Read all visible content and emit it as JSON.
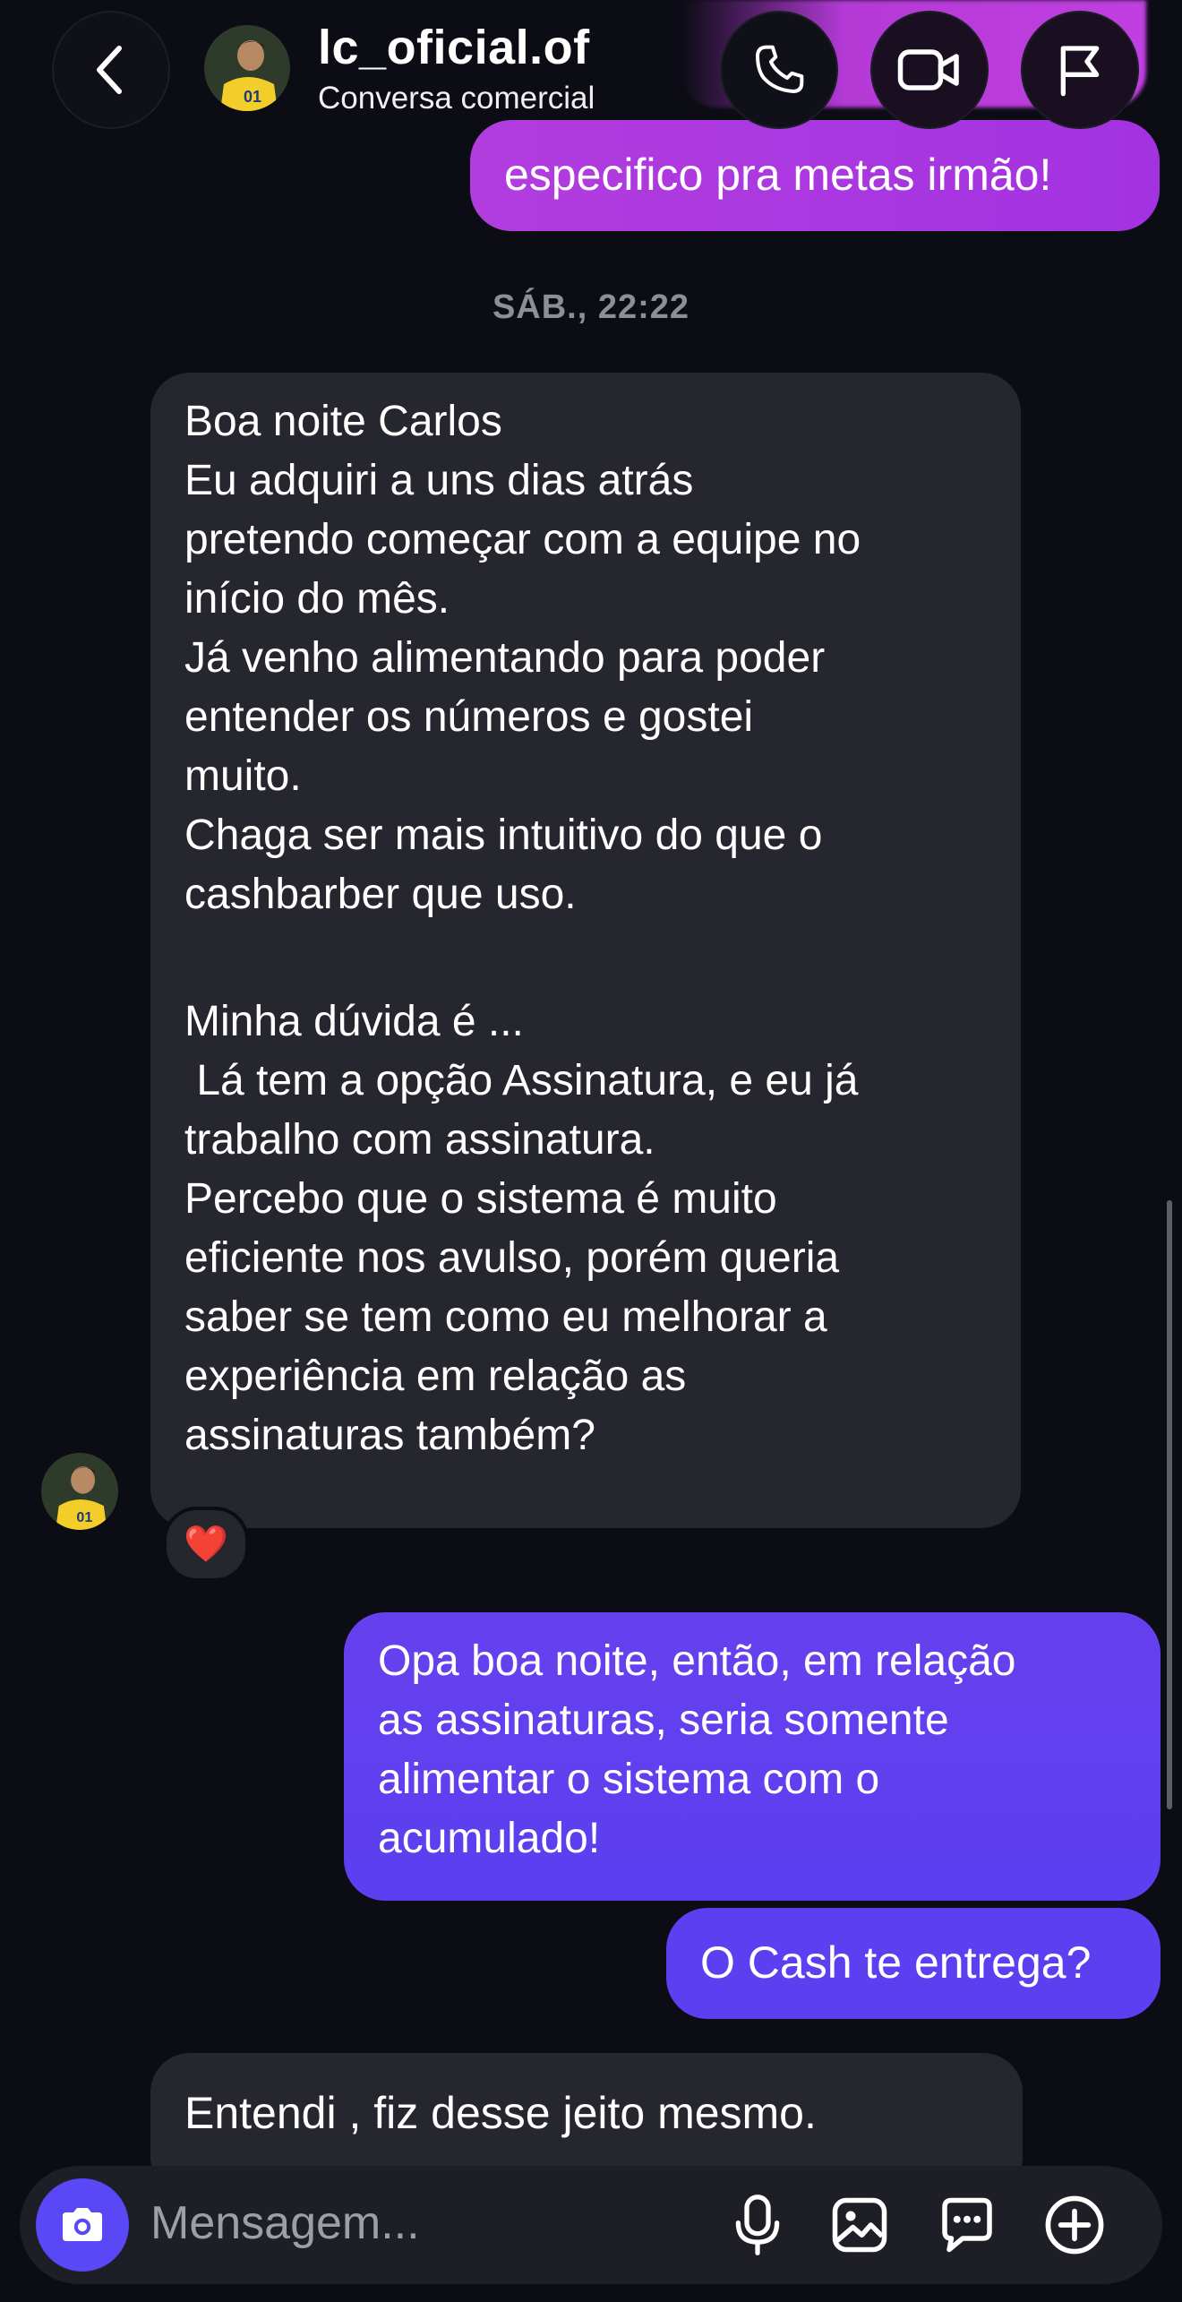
{
  "header": {
    "username": "lc_oficial.of",
    "subtitle": "Conversa comercial"
  },
  "top_partial_message": "especifico pra metas irmão!",
  "timestamp": "SÁB., 22:22",
  "incoming_message_1": {
    "lines": [
      "Boa noite Carlos",
      "Eu adquiri a uns dias atrás",
      "pretendo começar com a equipe no",
      "início do mês.",
      "Já venho alimentando para poder",
      "entender os números e gostei",
      "muito.",
      "Chaga ser mais intuitivo do que o",
      "cashbarber que uso.",
      "",
      "Minha dúvida é ...",
      " Lá tem a opção Assinatura, e eu já",
      "trabalho com assinatura.",
      "Percebo que o sistema é muito",
      "eficiente nos avulso, porém queria",
      "saber se tem como eu melhorar a",
      "experiência em relação as",
      "assinaturas também?"
    ],
    "reaction": "❤️"
  },
  "outgoing_message_1": {
    "lines": [
      "Opa boa noite, então, em relação",
      "as assinaturas, seria somente",
      "alimentar o sistema com o",
      "acumulado!"
    ]
  },
  "outgoing_message_2": "O Cash te entrega?",
  "incoming_message_2": "Entendi , fiz desse jeito mesmo.",
  "composer": {
    "placeholder": "Mensagem..."
  },
  "colors": {
    "background": "#0b0c14",
    "incoming_bubble": "#25262e",
    "outgoing_gradient_top": "#a235e0",
    "outgoing_purple": "#5b3ff0",
    "accent_camera": "#5a47f5"
  },
  "icons": {
    "back": "chevron-left-icon",
    "call": "phone-icon",
    "video": "video-camera-icon",
    "report": "flag-icon",
    "camera": "camera-icon",
    "mic": "microphone-icon",
    "gallery": "image-icon",
    "chat": "chat-bubble-icon",
    "add": "plus-circle-icon"
  }
}
